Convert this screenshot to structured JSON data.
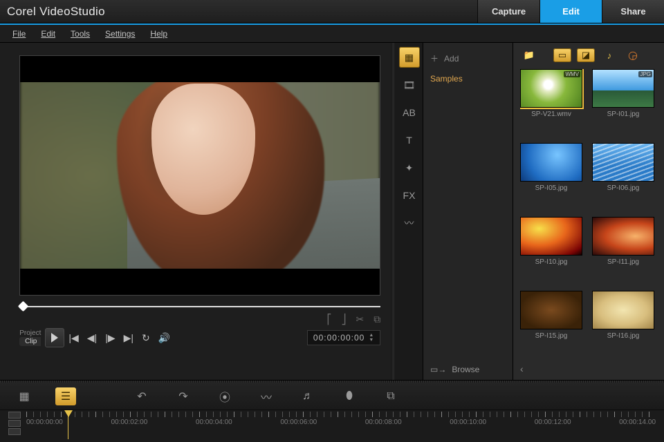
{
  "app_title": "Corel VideoStudio",
  "tabs": {
    "capture": "Capture",
    "edit": "Edit",
    "share": "Share",
    "active": "edit"
  },
  "menu": [
    "File",
    "Edit",
    "Tools",
    "Settings",
    "Help"
  ],
  "transport": {
    "project_label": "Project",
    "clip_label": "Clip",
    "timecode": "00:00:00:00"
  },
  "tool_column": {
    "fx_label": "FX",
    "ab_label": "AB",
    "t_label": "T"
  },
  "library": {
    "add_label": "Add",
    "folder": "Samples",
    "browse_label": "Browse",
    "items": [
      {
        "label": "SP-V21.wmv",
        "badge": "WMV"
      },
      {
        "label": "SP-I01.jpg",
        "badge": "JPG"
      },
      {
        "label": "SP-I05.jpg",
        "badge": ""
      },
      {
        "label": "SP-I06.jpg",
        "badge": ""
      },
      {
        "label": "SP-I10.jpg",
        "badge": ""
      },
      {
        "label": "SP-I11.jpg",
        "badge": ""
      },
      {
        "label": "SP-I15.jpg",
        "badge": ""
      },
      {
        "label": "SP-I16.jpg",
        "badge": ""
      }
    ]
  },
  "timeline": {
    "ticks": [
      "00:00:00:00",
      "",
      "00:00:02:00",
      "",
      "00:00:04:00",
      "",
      "00:00:06:00",
      "",
      "00:00:08:00",
      "",
      "00:00:10:00",
      "",
      "00:00:12:00",
      "",
      "00:00:14.00"
    ]
  }
}
